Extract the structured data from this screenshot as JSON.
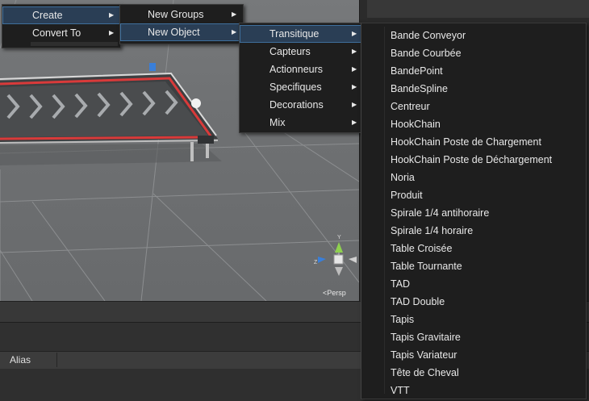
{
  "menus": {
    "level1": {
      "items": [
        {
          "label": "Create"
        },
        {
          "label": "Convert To"
        }
      ]
    },
    "level2": {
      "items": [
        {
          "label": "New Groups"
        },
        {
          "label": "New Object"
        }
      ]
    },
    "level3": {
      "items": [
        {
          "label": "Transitique"
        },
        {
          "label": "Capteurs"
        },
        {
          "label": "Actionneurs"
        },
        {
          "label": "Specifiques"
        },
        {
          "label": "Decorations"
        },
        {
          "label": "Mix"
        }
      ]
    },
    "level4": {
      "items": [
        {
          "label": "Bande Conveyor"
        },
        {
          "label": "Bande Courbée"
        },
        {
          "label": "BandePoint"
        },
        {
          "label": "BandeSpline"
        },
        {
          "label": "Centreur"
        },
        {
          "label": "HookChain"
        },
        {
          "label": "HookChain Poste de Chargement"
        },
        {
          "label": "HookChain Poste de Déchargement"
        },
        {
          "label": "Noria"
        },
        {
          "label": "Produit"
        },
        {
          "label": "Spirale 1/4 antihoraire"
        },
        {
          "label": "Spirale 1/4 horaire"
        },
        {
          "label": "Table Croisée"
        },
        {
          "label": "Table Tournante"
        },
        {
          "label": "TAD"
        },
        {
          "label": "TAD Double"
        },
        {
          "label": "Tapis"
        },
        {
          "label": "Tapis Gravitaire"
        },
        {
          "label": "Tapis Variateur"
        },
        {
          "label": "Tête de Cheval"
        },
        {
          "label": "VTT"
        }
      ]
    }
  },
  "scene": {
    "gizmo": {
      "axis_y": "Y",
      "axis_z": "Z"
    },
    "projection_label": "Persp"
  },
  "inspector": {
    "alias_label": "Alias"
  },
  "colors": {
    "menu_bg": "#1e1e1e",
    "menu_highlight": "#2a3e55",
    "conveyor_rail": "#d93a3a",
    "gizmo_y": "#8fd14f",
    "gizmo_x": "#d94040",
    "gizmo_z": "#3a7fd9"
  }
}
